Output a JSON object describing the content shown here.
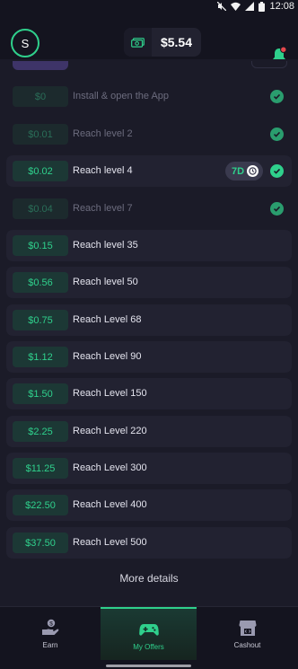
{
  "status_bar": {
    "time": "12:08",
    "icons": [
      "mute-icon",
      "wifi-icon",
      "signal-icon",
      "battery-icon"
    ]
  },
  "header": {
    "avatar_letter": "S",
    "balance": "$5.54",
    "balance_icon": "cash-icon",
    "bell_icon": "bell-icon"
  },
  "colors": {
    "accent": "#2fd08c",
    "background": "#1b1b28",
    "row": "#222231",
    "notification": "#e5484d"
  },
  "offer_rows": [
    {
      "reward": "$0",
      "label": "Install & open the App",
      "done": true
    },
    {
      "reward": "$0.01",
      "label": "Reach level 2",
      "done": true
    },
    {
      "reward": "$0.02",
      "label": "Reach level 4",
      "done": false,
      "checked": true,
      "badge": "7D"
    },
    {
      "reward": "$0.04",
      "label": "Reach level 7",
      "done": true
    },
    {
      "reward": "$0.15",
      "label": "Reach level 35"
    },
    {
      "reward": "$0.56",
      "label": "Reach level 50"
    },
    {
      "reward": "$0.75",
      "label": "Reach Level 68"
    },
    {
      "reward": "$1.12",
      "label": "Reach Level 90"
    },
    {
      "reward": "$1.50",
      "label": "Reach Level 150"
    },
    {
      "reward": "$2.25",
      "label": "Reach Level 220"
    },
    {
      "reward": "$11.25",
      "label": "Reach Level 300"
    },
    {
      "reward": "$22.50",
      "label": "Reach Level 400"
    },
    {
      "reward": "$37.50",
      "label": "Reach Level 500"
    }
  ],
  "more_details": "More details",
  "bottom_nav": [
    {
      "label": "Earn",
      "icon": "hand-coin-icon",
      "active": false
    },
    {
      "label": "My Offers",
      "icon": "gamepad-icon",
      "active": true
    },
    {
      "label": "Cashout",
      "icon": "store-icon",
      "active": false
    }
  ]
}
